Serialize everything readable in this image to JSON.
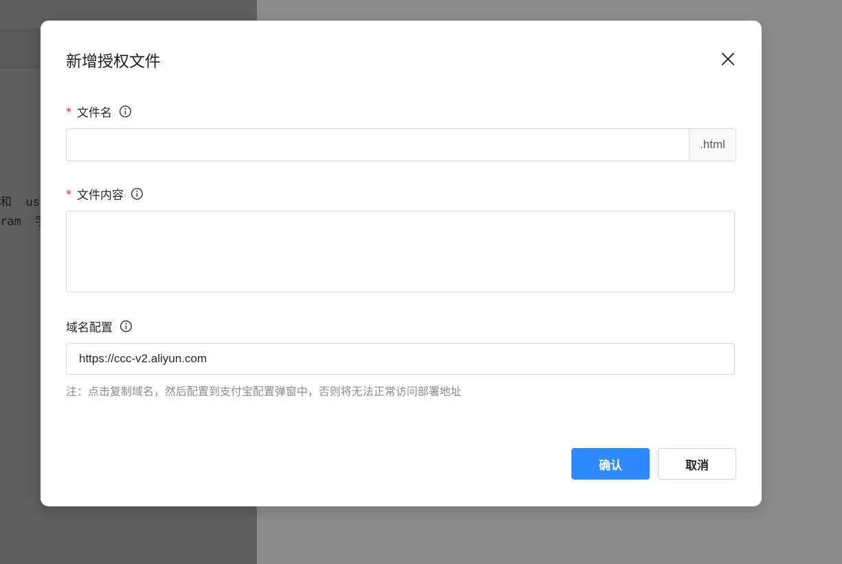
{
  "background": {
    "code_line_1": "和  use",
    "code_line_2": "ram  字"
  },
  "dialog": {
    "title": "新增授权文件",
    "close_icon": "close-icon",
    "fields": {
      "file_name": {
        "label": "文件名",
        "required": "*",
        "value": "",
        "placeholder": "",
        "suffix": ".html",
        "icon": "info-circle-icon"
      },
      "file_content": {
        "label": "文件内容",
        "required": "*",
        "value": "",
        "placeholder": "",
        "icon": "info-circle-icon"
      },
      "domain": {
        "label": "域名配置",
        "value": "https://ccc-v2.aliyun.com",
        "icon": "info-circle-icon"
      }
    },
    "note": "注：点击复制域名，然后配置到支付宝配置弹窗中，否则将无法正常访问部署地址",
    "buttons": {
      "confirm": "确认",
      "cancel": "取消"
    }
  },
  "colors": {
    "primary": "#2f8cff",
    "required": "#e02020",
    "overlay": "#8c8c8c"
  }
}
